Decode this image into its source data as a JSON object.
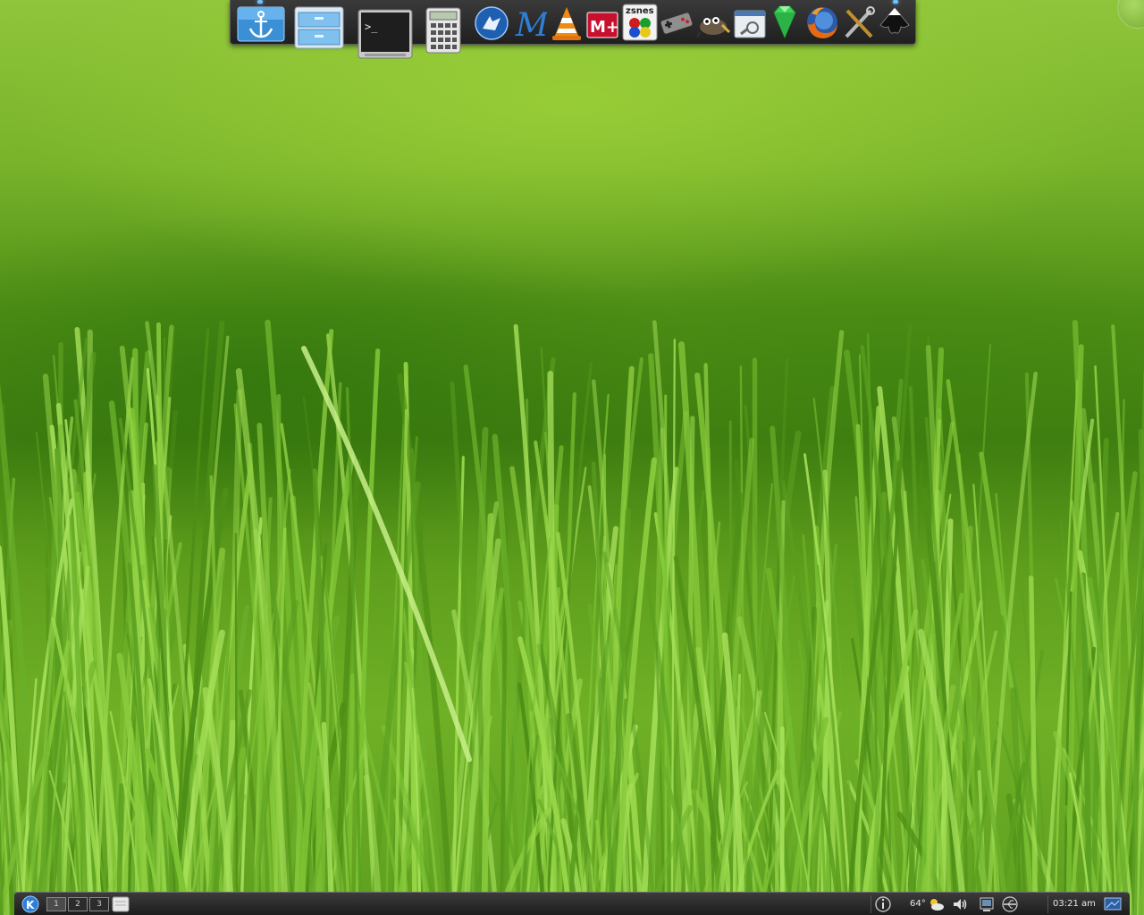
{
  "wallpaper": {
    "name": "green-grass-wallpaper",
    "colors": {
      "light": "#8fc53a",
      "mid": "#5e9e1c",
      "dark": "#3f7d10"
    }
  },
  "dock": {
    "launchers": [
      {
        "name": "anchor-icon",
        "label": ""
      },
      {
        "name": "file-manager-icon",
        "label": ""
      },
      {
        "name": "terminal-icon",
        "label": ">_"
      },
      {
        "name": "calculator-icon",
        "label": ""
      },
      {
        "name": "web-browser-wolf-icon",
        "label": ""
      },
      {
        "name": "m-app-icon",
        "label": "M"
      },
      {
        "name": "vlc-icon",
        "label": ""
      },
      {
        "name": "mame-icon",
        "label": "M+"
      },
      {
        "name": "zsnes-icon",
        "label": "zsnes"
      },
      {
        "name": "gamepad-emulator-icon",
        "label": ""
      },
      {
        "name": "gimp-icon",
        "label": ""
      },
      {
        "name": "system-settings-icon",
        "label": ""
      },
      {
        "name": "emerald-icon",
        "label": ""
      },
      {
        "name": "firefox-icon",
        "label": ""
      },
      {
        "name": "tools-icon",
        "label": ""
      },
      {
        "name": "inkscape-icon",
        "label": ""
      }
    ],
    "accent": "#6fc3ff"
  },
  "panel": {
    "pager": [
      "1",
      "2",
      "3"
    ],
    "active_desktop": "1",
    "weather_temp": "64°",
    "clock": "03:21 am",
    "tray_icons": [
      "info-icon",
      "weather-icon",
      "volume-icon",
      "network-icon",
      "usb-icon",
      "show-desktop-tray-icon"
    ]
  }
}
